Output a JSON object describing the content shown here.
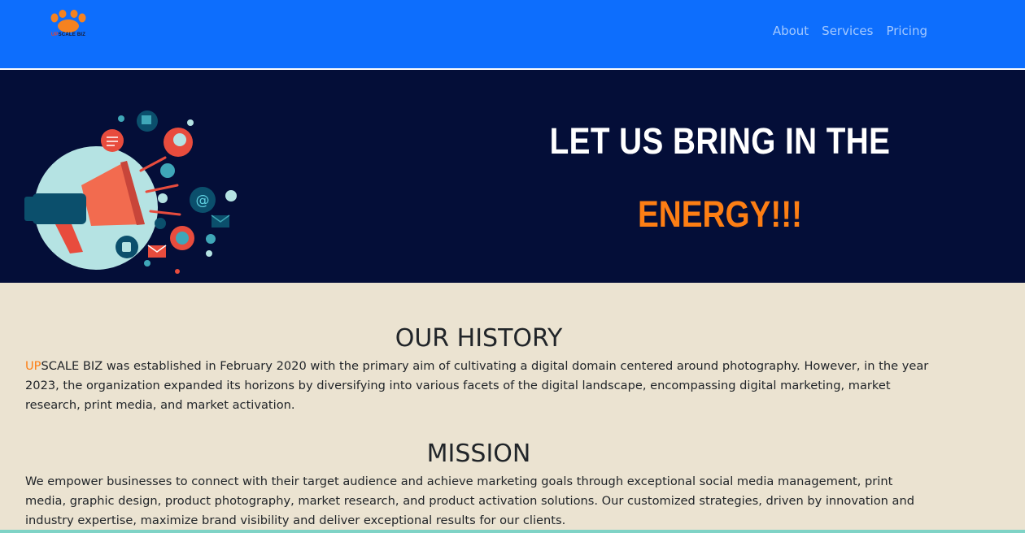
{
  "brand": {
    "logo_prefix": "UP",
    "logo_suffix": "SCALE BIZ",
    "logo_icon": "paw-icon",
    "colors": {
      "navbar": "#0d6efd",
      "hero_bg": "#040e38",
      "accent": "#fd7e14",
      "page_bg": "#ebe3d1"
    }
  },
  "nav": {
    "links": [
      {
        "label": "About"
      },
      {
        "label": "Services"
      },
      {
        "label": "Pricing"
      }
    ]
  },
  "hero": {
    "illustration": "megaphone-marketing-illustration",
    "line1": "LET US BRING IN THE",
    "line2": "ENERGY!!!"
  },
  "history": {
    "title": "OUR HISTORY",
    "brand_prefix": "UP",
    "body": "SCALE BIZ was established in February 2020 with the primary aim of cultivating a digital domain centered around photography. However, in the year 2023, the organization expanded its horizons by diversifying into various facets of the digital landscape, encompassing digital marketing, market research, print media, and market activation."
  },
  "mission": {
    "title": "MISSION",
    "body": "We empower businesses to connect with their target audience and achieve marketing goals through exceptional social media management, print media, graphic design, product photography, market research, and product activation solutions. Our customized strategies, driven by innovation and industry expertise, maximize brand visibility and deliver exceptional results for our clients."
  }
}
